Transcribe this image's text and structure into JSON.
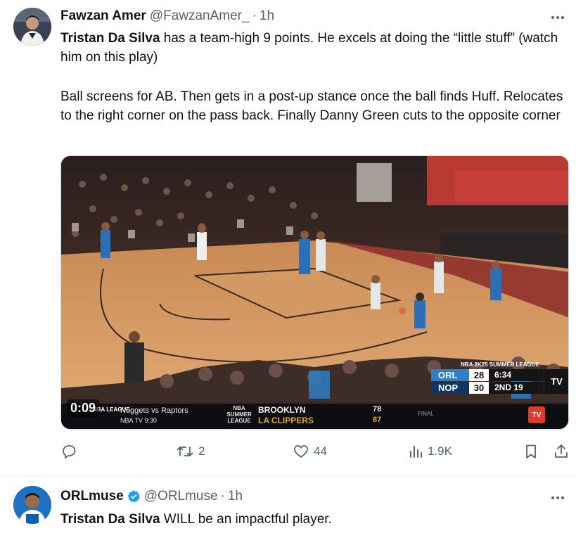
{
  "tweet1": {
    "author_name": "Fawzan Amer",
    "handle": "@FawzanAmer_",
    "separator": "·",
    "time": "1h",
    "text_line1_bold": "Tristan Da Silva",
    "text_line1_rest": " has a team-high 9 points. He excels at doing the “little stuff” (watch him on this play)",
    "text_para2": "Ball screens for AB. Then gets in a post-up stance once the ball finds Huff. Relocates to the right corner on the pass back. Finally Danny Green cuts to the opposite corner",
    "video": {
      "elapsed": "0:09",
      "ticker_league": "NBA LEAGUE",
      "ticker_game": "Nuggets vs Raptors",
      "ticker_channel": "NBA TV 9:30",
      "summer_league_label": "NBA SUMMER LEAGUE",
      "team1": "BROOKLYN",
      "team2": "LA CLIPPERS",
      "score1": "78",
      "score2": "87",
      "status": "FINAL",
      "live_header": "NBA 2K25 SUMMER LEAGUE",
      "live_team1": "ORL",
      "live_team2": "NOP",
      "live_score1": "28",
      "live_score2": "30",
      "live_clock": "6:34",
      "live_period": "2ND 19",
      "tv_badge": "TV"
    },
    "actions": {
      "reposts": "2",
      "likes": "44",
      "views": "1.9K"
    }
  },
  "tweet2": {
    "author_name": "ORLmuse",
    "handle": "@ORLmuse",
    "separator": "·",
    "time": "1h",
    "text_bold": "Tristan Da Silva",
    "text_rest": " WILL be an impactful player."
  },
  "colors": {
    "text_primary": "#0f1419",
    "text_secondary": "#536471",
    "verified_blue": "#1d9bf0",
    "magic_blue": "#2d80c9"
  },
  "icons": [
    "more-icon",
    "reply-icon",
    "repost-icon",
    "like-icon",
    "views-icon",
    "bookmark-icon",
    "share-icon",
    "verified-icon"
  ]
}
